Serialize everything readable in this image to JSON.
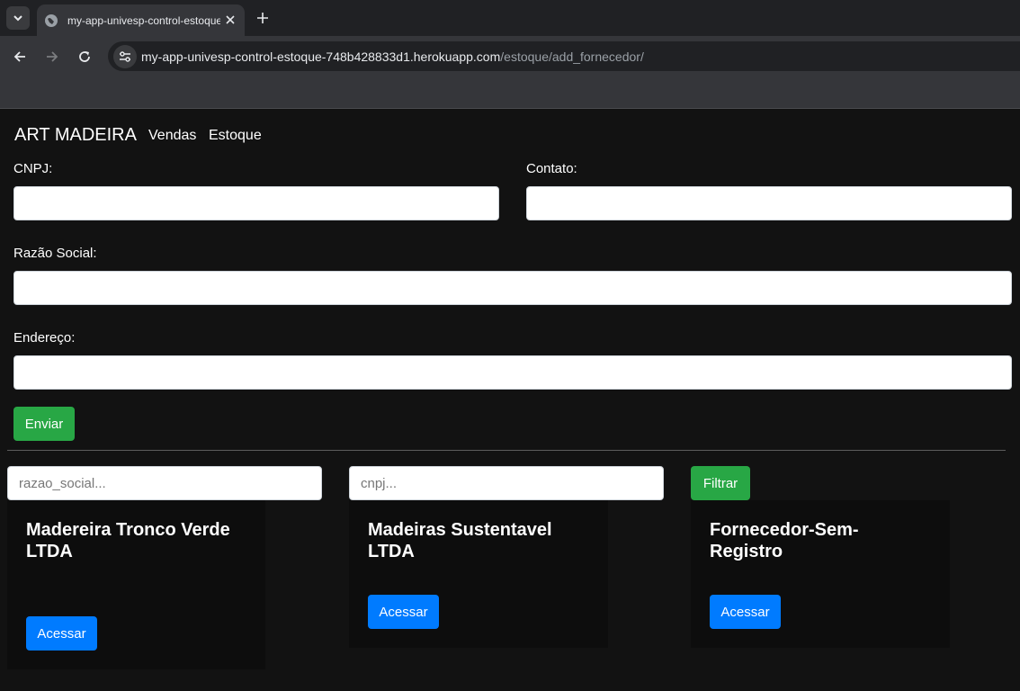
{
  "browser": {
    "tab_title": "my-app-univesp-control-estoque",
    "url_host": "my-app-univesp-control-estoque-748b428833d1.herokuapp.com",
    "url_path": "/estoque/add_fornecedor/"
  },
  "navbar": {
    "brand": "ART MADEIRA",
    "links": [
      "Vendas",
      "Estoque"
    ]
  },
  "form": {
    "cnpj_label": "CNPJ:",
    "contato_label": "Contato:",
    "razao_label": "Razão Social:",
    "endereco_label": "Endereço:",
    "cnpj_value": "",
    "contato_value": "",
    "razao_value": "",
    "endereco_value": "",
    "submit_label": "Enviar"
  },
  "filter": {
    "razao_placeholder": "razao_social...",
    "cnpj_placeholder": "cnpj...",
    "button_label": "Filtrar"
  },
  "suppliers": [
    {
      "name": "Madereira Tronco Verde LTDA",
      "action": "Acessar"
    },
    {
      "name": "Madeiras Sustentavel LTDA",
      "action": "Acessar"
    },
    {
      "name": "Fornecedor-Sem-Registro",
      "action": "Acessar"
    }
  ],
  "colors": {
    "success": "#28a745",
    "primary": "#007bff",
    "background": "#121212"
  }
}
